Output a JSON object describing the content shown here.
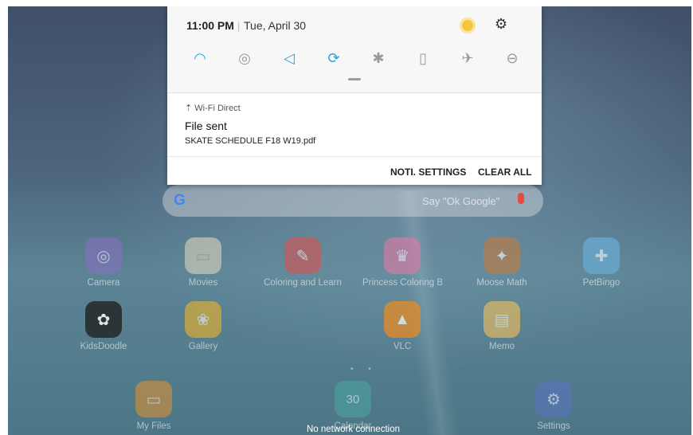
{
  "shade": {
    "time": "11:00 PM",
    "separator": "|",
    "date": "Tue, April 30",
    "quick_settings": [
      {
        "name": "wifi-icon",
        "on": true,
        "glyph": "◐"
      },
      {
        "name": "location-icon",
        "on": false,
        "glyph": "◎"
      },
      {
        "name": "sound-icon",
        "on": true,
        "glyph": "◁"
      },
      {
        "name": "auto-rotate-icon",
        "on": true,
        "glyph": "⟳"
      },
      {
        "name": "bluetooth-icon",
        "on": false,
        "glyph": "✱"
      },
      {
        "name": "power-saving-icon",
        "on": false,
        "glyph": "□"
      },
      {
        "name": "airplane-mode-icon",
        "on": false,
        "glyph": "✈"
      },
      {
        "name": "do-not-disturb-icon",
        "on": false,
        "glyph": "⊖"
      }
    ],
    "notification": {
      "app": "Wi-Fi Direct",
      "title": "File sent",
      "body": "SKATE SCHEDULE F18 W19.pdf"
    },
    "actions": {
      "settings_label": "NOTI. SETTINGS",
      "clear_label": "CLEAR ALL"
    }
  },
  "search": {
    "logo": "G",
    "placeholder": "Say \"Ok Google\""
  },
  "apps": [
    {
      "label": "Camera",
      "color": "#8b6ec4",
      "icon": "camera-icon"
    },
    {
      "label": "Movies",
      "color": "#e8dcc0",
      "icon": "folder-icon"
    },
    {
      "label": "Coloring and Learn",
      "color": "#d9534f",
      "icon": "coloring-icon"
    },
    {
      "label": "Princess Coloring B...",
      "color": "#e27aa5",
      "icon": "princess-icon"
    },
    {
      "label": "Moose Math",
      "color": "#c57a3c",
      "icon": "moose-icon"
    },
    {
      "label": "PetBingo",
      "color": "#6cb4e0",
      "icon": "petbingo-icon"
    },
    {
      "label": "KidsDoodle",
      "color": "#222222",
      "icon": "kidsdoodle-icon"
    },
    {
      "label": "Gallery",
      "color": "#f0b429",
      "icon": "gallery-icon"
    },
    {
      "label": "VLC",
      "color": "#f28c1c",
      "icon": "vlc-icon"
    },
    {
      "label": "Memo",
      "color": "#f7c15a",
      "icon": "memo-icon"
    }
  ],
  "dock": [
    {
      "label": "My Files",
      "color": "#e8922e",
      "icon": "myfiles-icon"
    },
    {
      "label": "Calendar",
      "color": "#49a6a0",
      "icon": "calendar-icon",
      "day": "30"
    },
    {
      "label": "Settings",
      "color": "#5a74c4",
      "icon": "settings-icon"
    }
  ],
  "page_dots": "• •",
  "status_message": "No network connection"
}
